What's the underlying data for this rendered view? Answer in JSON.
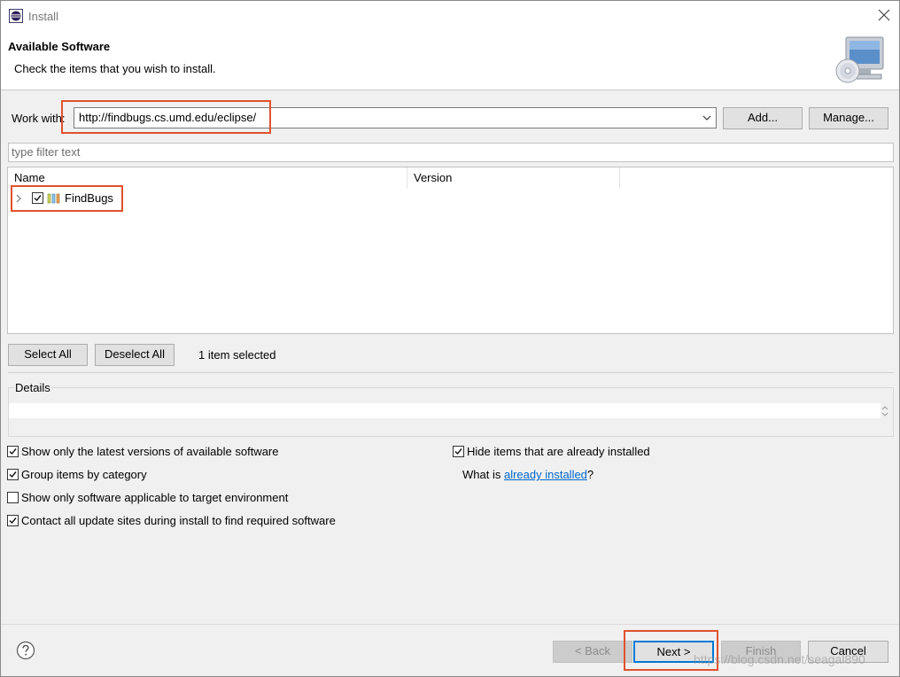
{
  "window": {
    "title": "Install"
  },
  "header": {
    "title": "Available Software",
    "subtitle": "Check the items that you wish to install."
  },
  "work_with": {
    "label": "Work with:",
    "value": "http://findbugs.cs.umd.edu/eclipse/",
    "add_label": "Add...",
    "manage_label": "Manage..."
  },
  "filter": {
    "placeholder": "type filter text"
  },
  "table": {
    "columns": [
      "Name",
      "Version"
    ],
    "rows": [
      {
        "name": "FindBugs",
        "version": "",
        "checked": true
      }
    ]
  },
  "selection": {
    "select_all_label": "Select All",
    "deselect_all_label": "Deselect All",
    "status": "1 item selected"
  },
  "details": {
    "label": "Details",
    "value": ""
  },
  "options": {
    "latest_versions": {
      "label": "Show only the latest versions of available software",
      "checked": true
    },
    "group_by_category": {
      "label": "Group items by category",
      "checked": true
    },
    "target_env": {
      "label": "Show only software applicable to target environment",
      "checked": false
    },
    "contact_sites": {
      "label": "Contact all update sites during install to find required software",
      "checked": true
    },
    "hide_installed": {
      "label": "Hide items that are already installed",
      "checked": true
    },
    "already_installed_prefix": "What is ",
    "already_installed_link": "already installed",
    "already_installed_suffix": "?"
  },
  "footer": {
    "back_label": "< Back",
    "next_label": "Next >",
    "finish_label": "Finish",
    "cancel_label": "Cancel"
  },
  "watermark": "https://blog.csdn.net/seagal890",
  "colors": {
    "highlight": "#e0522d",
    "focus": "#0078d7",
    "link": "#0066cc"
  }
}
